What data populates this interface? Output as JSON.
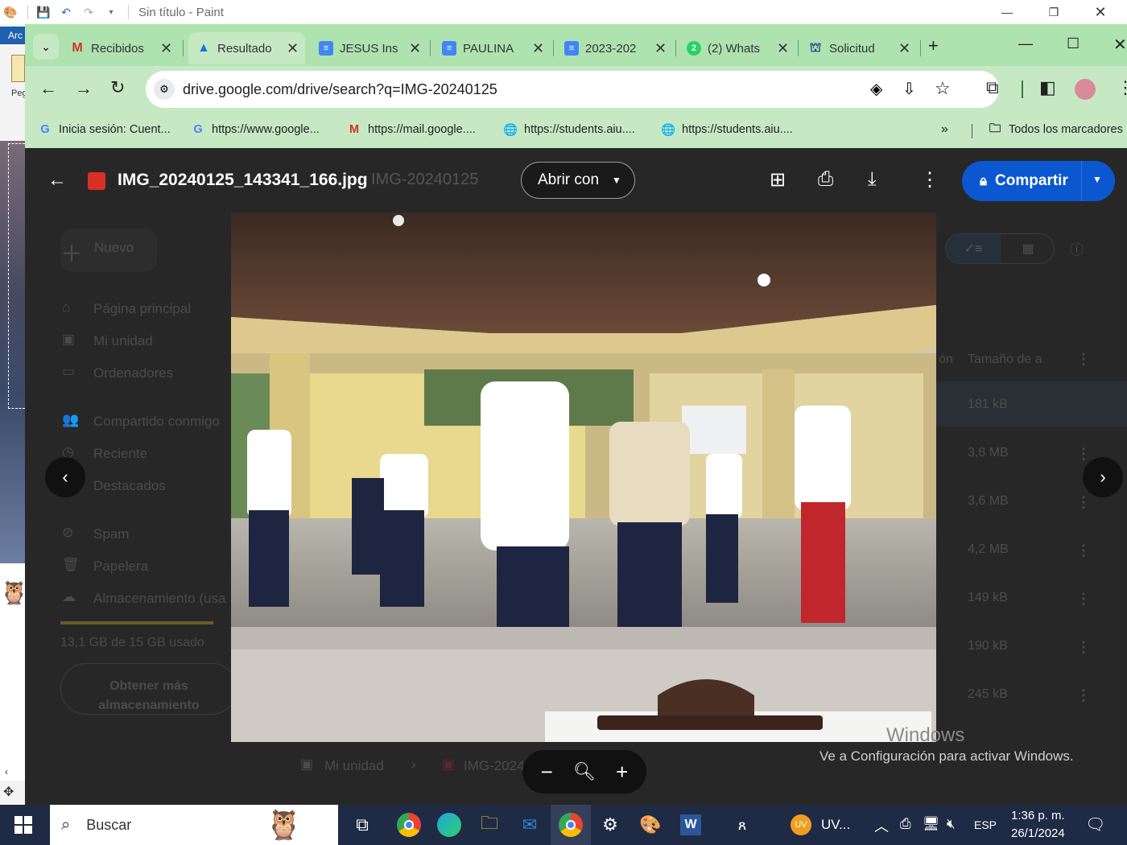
{
  "paint": {
    "title": "Sin título - Paint",
    "tab_label": "Arc",
    "side_label": "Peg"
  },
  "browser": {
    "tabs": [
      {
        "label": "Recibidos",
        "icon": "gmail-icon"
      },
      {
        "label": "Resultado",
        "icon": "google-drive-icon",
        "active": true
      },
      {
        "label": "JESUS Ins",
        "icon": "google-docs-icon"
      },
      {
        "label": "PAULINA",
        "icon": "google-docs-icon"
      },
      {
        "label": "2023-202",
        "icon": "google-docs-icon"
      },
      {
        "label": "(2) Whats",
        "icon": "whatsapp-icon"
      },
      {
        "label": "Solicitud",
        "icon": "government-icon"
      }
    ],
    "url": "drive.google.com/drive/search?q=IMG-20240125",
    "bookmarks": [
      {
        "label": "Inicia sesión: Cuent...",
        "icon": "google-icon"
      },
      {
        "label": "https://www.google...",
        "icon": "google-icon"
      },
      {
        "label": "https://mail.google....",
        "icon": "gmail-icon"
      },
      {
        "label": "https://students.aiu....",
        "icon": "globe-icon"
      },
      {
        "label": "https://students.aiu....",
        "icon": "globe-icon"
      }
    ],
    "all_bookmarks": "Todos los marcadores"
  },
  "drive_bg": {
    "search_text": "IMG-20240125",
    "new_button": "Nuevo",
    "nav": [
      "Página principal",
      "Mi unidad",
      "Ordenadores",
      "Compartido conmigo",
      "Reciente",
      "Destacados",
      "Spam",
      "Papelera",
      "Almacenamiento (usa"
    ],
    "storage_text": "13,1 GB de 15 GB usado",
    "storage_button": "Obtener más almacenamiento",
    "column_header_short": "ón",
    "column_header_size": "Tamaño de a",
    "sizes": [
      "181 kB",
      "3,8 MB",
      "3,6 MB",
      "4,2 MB",
      "149 kB",
      "190 kB",
      "245 kB"
    ],
    "breadcrumb_root": "Mi unidad",
    "breadcrumb_file": "IMG-2024"
  },
  "viewer": {
    "file_name": "IMG_20240125_143341_166.jpg",
    "open_with": "Abrir con",
    "share": "Compartir"
  },
  "activation": {
    "title": "Windows",
    "text": "Ve a Configuración para activar Windows."
  },
  "taskbar": {
    "search": "Buscar",
    "user_app": "UV...",
    "language": "ESP",
    "time": "1:36 p. m.",
    "date": "26/1/2024"
  }
}
